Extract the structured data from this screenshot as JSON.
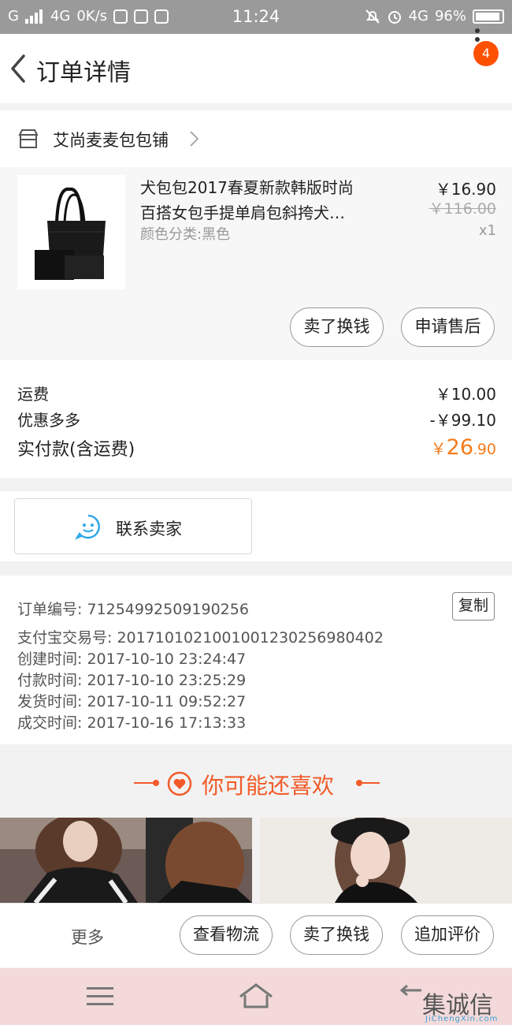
{
  "status_bar": {
    "signal": "G",
    "network": "4G",
    "speed": "0K/s",
    "time": "11:24",
    "network_right": "4G",
    "battery": "96%"
  },
  "header": {
    "title": "订单详情",
    "badge_count": "4"
  },
  "shop": {
    "name": "艾尚麦麦包包铺"
  },
  "product": {
    "title_line1": "犬包包2017春夏新款韩版时尚",
    "title_line2": "百搭女包手提单肩包斜挎犬…",
    "sku": "颜色分类:黑色",
    "price": "￥16.90",
    "original_price": "￥116.00",
    "quantity": "x1",
    "sell_button": "卖了换钱",
    "after_sale_button": "申请售后"
  },
  "fees": {
    "shipping_label": "运费",
    "shipping_value": "￥10.00",
    "discount_label": "优惠多多",
    "discount_value": "-￥99.10",
    "total_label": "实付款(含运费)",
    "total_currency": "￥",
    "total_int": "26",
    "total_dec": "90"
  },
  "contact": {
    "label": "联系卖家"
  },
  "order_info": {
    "order_no": "订单编号: 71254992509190256",
    "copy_button": "复制",
    "alipay_no": "支付宝交易号: 2017101021001001230256980402",
    "created": "创建时间: 2017-10-10  23:24:47",
    "paid": "付款时间: 2017-10-10  23:25:29",
    "shipped": "发货时间: 2017-10-11  09:52:27",
    "completed": "成交时间: 2017-10-16  17:13:33"
  },
  "recommend": {
    "title": "你可能还喜欢"
  },
  "action_bar": {
    "more": "更多",
    "logistics": "查看物流",
    "sell": "卖了换钱",
    "review": "追加评价"
  },
  "watermark": {
    "text": "集诚信",
    "sub": "JiChengXin.com"
  },
  "colors": {
    "accent_orange": "#f57b1a",
    "badge_red": "#ff5000",
    "contact_blue": "#2fa7e8"
  }
}
